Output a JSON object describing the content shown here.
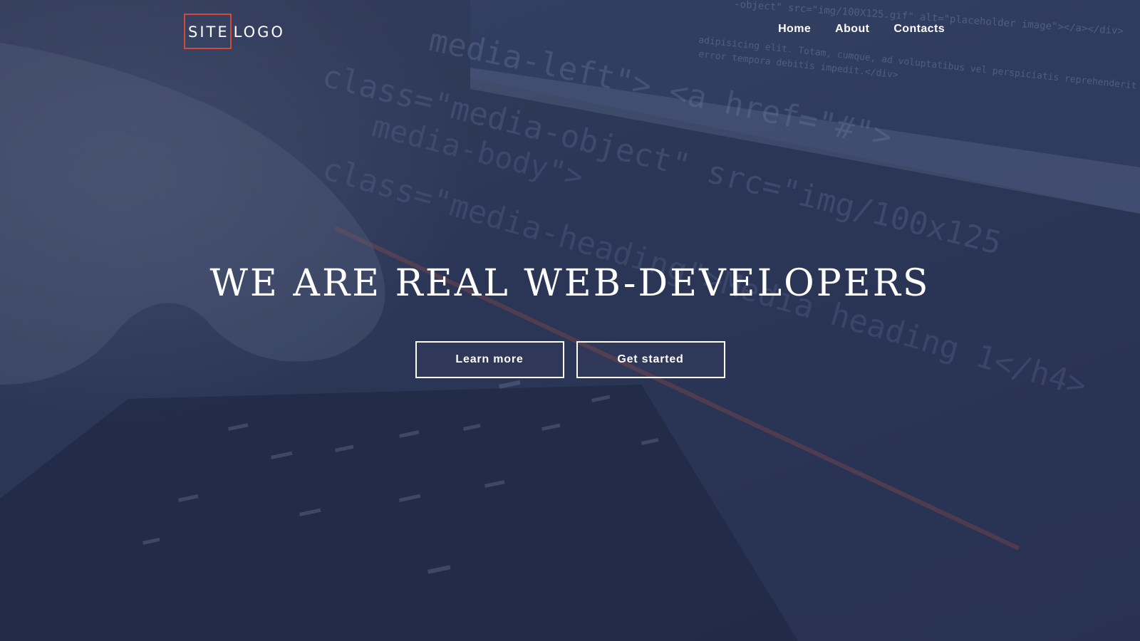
{
  "brand": {
    "logo_word1": "SITE",
    "logo_word2": "LOGO",
    "accent_color": "#d24a3a"
  },
  "nav": {
    "items": [
      {
        "label": "Home"
      },
      {
        "label": "About"
      },
      {
        "label": "Contacts"
      }
    ]
  },
  "hero": {
    "headline": "WE ARE REAL WEB-DEVELOPERS",
    "buttons": [
      {
        "label": "Learn more"
      },
      {
        "label": "Get started"
      }
    ],
    "background_code_lines": [
      "-object\" src=\"img/100X125.gif\" alt=\"placeholder image\"></a></div>",
      "adipisicing elit. Totam, cumque, ad voluptatibus vel perspiciatis reprehenderit",
      "error tempora debitis impedit.</div>",
      "media-left\"> <a href=\"#\">",
      "class=\"media-object\" src=\"img/100x125",
      "media-body\">",
      "class=\"media-heading\">Media heading 1</h4>"
    ]
  },
  "colors": {
    "background": "#2b3553",
    "text": "#ffffff"
  }
}
